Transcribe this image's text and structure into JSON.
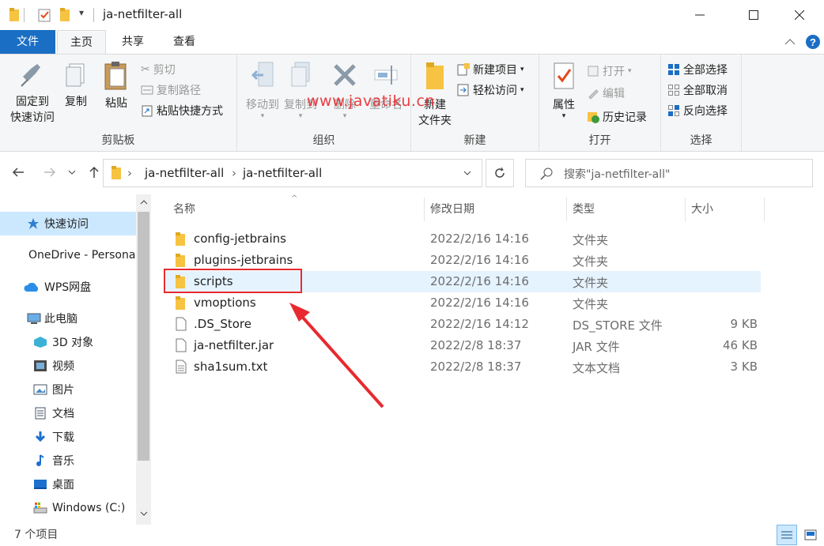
{
  "window": {
    "title": "ja-netfilter-all",
    "qa_dropdown": "▾"
  },
  "tabs": [
    {
      "label": "文件"
    },
    {
      "label": "主页"
    },
    {
      "label": "共享"
    },
    {
      "label": "查看"
    }
  ],
  "ribbon": {
    "clipboard": {
      "label": "剪贴板",
      "pin_line1": "固定到",
      "pin_line2": "快速访问",
      "copy": "复制",
      "paste": "粘贴",
      "cut": "剪切",
      "copy_path": "复制路径",
      "paste_shortcut": "粘贴快捷方式"
    },
    "organize": {
      "label": "组织",
      "move_to": "移动到",
      "copy_to": "复制到",
      "delete": "删除",
      "rename": "重命名"
    },
    "new": {
      "label": "新建",
      "new_folder_line1": "新建",
      "new_folder_line2": "文件夹",
      "new_item": "新建项目",
      "easy_access": "轻松访问"
    },
    "open": {
      "label": "打开",
      "properties": "属性",
      "open": "打开",
      "edit": "编辑",
      "history": "历史记录"
    },
    "select": {
      "label": "选择",
      "select_all": "全部选择",
      "select_none": "全部取消",
      "invert": "反向选择"
    }
  },
  "address": {
    "crumbs": [
      "ja-netfilter-all",
      "ja-netfilter-all"
    ],
    "search_placeholder": "搜索\"ja-netfilter-all\""
  },
  "sidebar": {
    "items": [
      {
        "label": "快速访问",
        "icon": "star-icon"
      },
      {
        "label": "OneDrive - Personal",
        "icon": "onedrive-cloud-icon"
      },
      {
        "label": "WPS网盘",
        "icon": "wps-cloud-icon"
      },
      {
        "label": "此电脑",
        "icon": "pc-icon"
      },
      {
        "label": "3D 对象",
        "icon": "3d-objects-icon"
      },
      {
        "label": "视频",
        "icon": "video-icon"
      },
      {
        "label": "图片",
        "icon": "pictures-icon"
      },
      {
        "label": "文档",
        "icon": "documents-icon"
      },
      {
        "label": "下载",
        "icon": "download-icon"
      },
      {
        "label": "音乐",
        "icon": "music-icon"
      },
      {
        "label": "桌面",
        "icon": "desktop-icon"
      },
      {
        "label": "Windows (C:)",
        "icon": "drive-icon"
      }
    ]
  },
  "columns": {
    "name": "名称",
    "modified": "修改日期",
    "type": "类型",
    "size": "大小"
  },
  "files": [
    {
      "name": "config-jetbrains",
      "modified": "2022/2/16 14:16",
      "type": "文件夹",
      "size": "",
      "icon": "folder-icon"
    },
    {
      "name": "plugins-jetbrains",
      "modified": "2022/2/16 14:16",
      "type": "文件夹",
      "size": "",
      "icon": "folder-icon"
    },
    {
      "name": "scripts",
      "modified": "2022/2/16 14:16",
      "type": "文件夹",
      "size": "",
      "icon": "folder-icon"
    },
    {
      "name": "vmoptions",
      "modified": "2022/2/16 14:16",
      "type": "文件夹",
      "size": "",
      "icon": "folder-icon"
    },
    {
      "name": ".DS_Store",
      "modified": "2022/2/16 14:12",
      "type": "DS_STORE 文件",
      "size": "9 KB",
      "icon": "file-icon"
    },
    {
      "name": "ja-netfilter.jar",
      "modified": "2022/2/8 18:37",
      "type": "JAR 文件",
      "size": "46 KB",
      "icon": "file-icon"
    },
    {
      "name": "sha1sum.txt",
      "modified": "2022/2/8 18:37",
      "type": "文本文档",
      "size": "3 KB",
      "icon": "text-file-icon"
    }
  ],
  "status": {
    "count": "7 个项目"
  },
  "watermark": "www.javatiku.cn",
  "colors": {
    "accent": "#1a6ec4",
    "selection": "#cce8ff",
    "annotation": "#e8292f",
    "folder": "#f6c342"
  }
}
